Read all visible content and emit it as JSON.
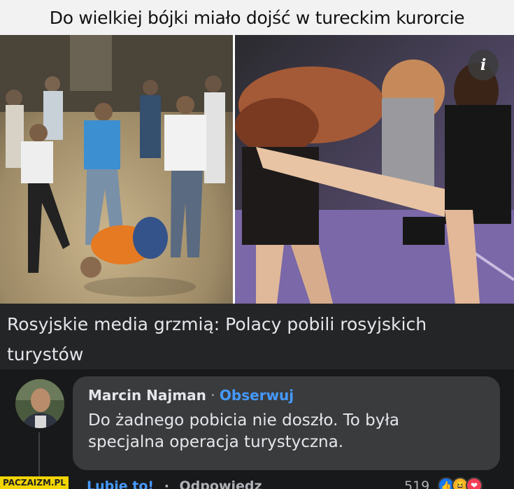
{
  "banner": {
    "title": "Do wielkiej bójki miało dojść w tureckim kurorcie"
  },
  "info_button": {
    "label": "i"
  },
  "headline": {
    "line1": "Rosyjskie media grzmią: Polacy pobili rosyjskich",
    "line2": "turystów"
  },
  "comment": {
    "author": "Marcin Najman",
    "separator": "·",
    "follow_label": "Obserwuj",
    "text_line1": "Do żadnego pobicia nie doszło. To była",
    "text_line2": "specjalna operacja turystyczna.",
    "like_label": "Lubię to!",
    "reply_label": "Odpowiedz",
    "reaction_count": "519",
    "reactions": [
      "like-icon",
      "haha-icon",
      "love-icon"
    ]
  },
  "watermark": {
    "text": "PACZAIZM.PL"
  },
  "colors": {
    "banner_bg": "#f2f2f2",
    "panel_bg": "#242526",
    "bubble_bg": "#3a3b3c",
    "link_blue": "#4599ff",
    "watermark_bg": "#f2d500"
  }
}
